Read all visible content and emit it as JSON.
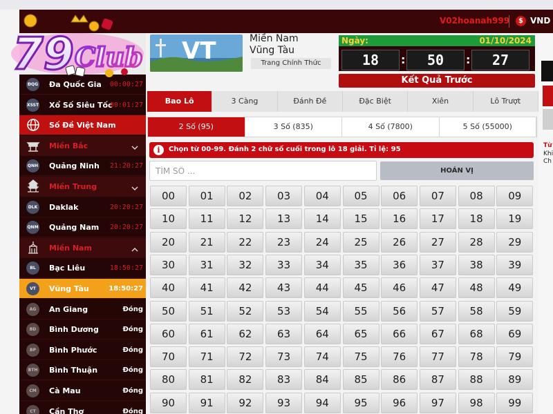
{
  "header": {
    "username": "V02hoanah999",
    "coin_symbol": "$",
    "currency": "VND"
  },
  "logo": {
    "text": "79Club"
  },
  "sidebar": {
    "items": [
      {
        "kind": "game",
        "icon": "ĐQG",
        "label": "Đa Quốc Gia",
        "time": "00:00:27"
      },
      {
        "kind": "game",
        "icon": "XSST",
        "label": "Xổ Số Siêu Tốc",
        "time": "00:01:27"
      },
      {
        "kind": "highlight",
        "label": "Số Đề Việt Nam"
      },
      {
        "kind": "group",
        "label": "Miền Bắc"
      },
      {
        "kind": "game",
        "icon": "QNH",
        "label": "Quảng Ninh",
        "time": "21:20:27"
      },
      {
        "kind": "group",
        "label": "Miền Trung"
      },
      {
        "kind": "game",
        "icon": "DLK",
        "label": "Daklak",
        "time": "20:20:27"
      },
      {
        "kind": "game",
        "icon": "QNM",
        "label": "Quảng Nam",
        "time": "20:20:27"
      },
      {
        "kind": "group",
        "label": "Miền Nam"
      },
      {
        "kind": "game",
        "icon": "BL",
        "label": "Bạc Liêu",
        "time": "18:50:27"
      },
      {
        "kind": "selected",
        "icon": "VT",
        "label": "Vũng Tàu",
        "time": "18:50:27"
      },
      {
        "kind": "closed",
        "icon": "AG",
        "label": "An Giang",
        "time": "Đóng"
      },
      {
        "kind": "closed",
        "icon": "BD",
        "label": "Bình Dương",
        "time": "Đóng"
      },
      {
        "kind": "closed",
        "icon": "BP",
        "label": "Bình Phước",
        "time": "Đóng"
      },
      {
        "kind": "closed",
        "icon": "BTH",
        "label": "Bình Thuận",
        "time": "Đóng"
      },
      {
        "kind": "closed",
        "icon": "CM",
        "label": "Cà Mau",
        "time": "Đóng"
      },
      {
        "kind": "closed",
        "icon": "CT",
        "label": "Cần Thơ",
        "time": "Đóng"
      }
    ]
  },
  "province": {
    "thumb_text": "VT",
    "region": "Miền Nam",
    "name": "Vũng Tàu",
    "main_page_label": "Trang Chính Thức"
  },
  "draw": {
    "date_label": "Ngày:",
    "date": "01/10/2024",
    "hours": "18",
    "minutes": "50",
    "seconds": "27",
    "prev_results_label": "Kết Quả Trước"
  },
  "bet_type_tabs": [
    "Bao Lô",
    "3 Càng",
    "Đánh Đề",
    "Đặc Biệt",
    "Xiên",
    "Lô Trượt"
  ],
  "active_bet_type": 0,
  "sub_tabs": [
    "2 Số (95)",
    "3 Số (835)",
    "4 Số (7800)",
    "5 Số (55000)"
  ],
  "active_sub_tab": 0,
  "info_text": "Chọn từ 00-99. Đánh 2 chữ số cuối trong lô 18 giải. Tỉ lệ: 95",
  "search": {
    "placeholder": "TÌM SỐ ...",
    "value": ""
  },
  "permute_label": "HOÁN VỊ",
  "numbers": [
    "00",
    "01",
    "02",
    "03",
    "04",
    "05",
    "06",
    "07",
    "08",
    "09",
    "10",
    "11",
    "12",
    "13",
    "14",
    "15",
    "16",
    "17",
    "18",
    "19",
    "20",
    "21",
    "22",
    "23",
    "24",
    "25",
    "26",
    "27",
    "28",
    "29",
    "30",
    "31",
    "32",
    "33",
    "34",
    "35",
    "36",
    "37",
    "38",
    "39",
    "40",
    "41",
    "42",
    "43",
    "44",
    "45",
    "46",
    "47",
    "48",
    "49",
    "50",
    "51",
    "52",
    "53",
    "54",
    "55",
    "56",
    "57",
    "58",
    "59",
    "60",
    "61",
    "62",
    "63",
    "64",
    "65",
    "66",
    "67",
    "68",
    "69",
    "70",
    "71",
    "72",
    "73",
    "74",
    "75",
    "76",
    "77",
    "78",
    "79",
    "80",
    "81",
    "82",
    "83",
    "84",
    "85",
    "86",
    "87",
    "88",
    "89",
    "90",
    "91",
    "92",
    "93",
    "94",
    "95",
    "96",
    "97",
    "98",
    "99"
  ],
  "right_panel": {
    "line1": "Từ",
    "line2": "Khi",
    "line3": "Ch"
  },
  "colors": {
    "primary_red": "#c10f12",
    "dark_maroon": "#2a0708",
    "selected_orange": "#f3a01a",
    "accent_green": "#1f9a3a",
    "accent_yellow": "#f4d23a"
  }
}
